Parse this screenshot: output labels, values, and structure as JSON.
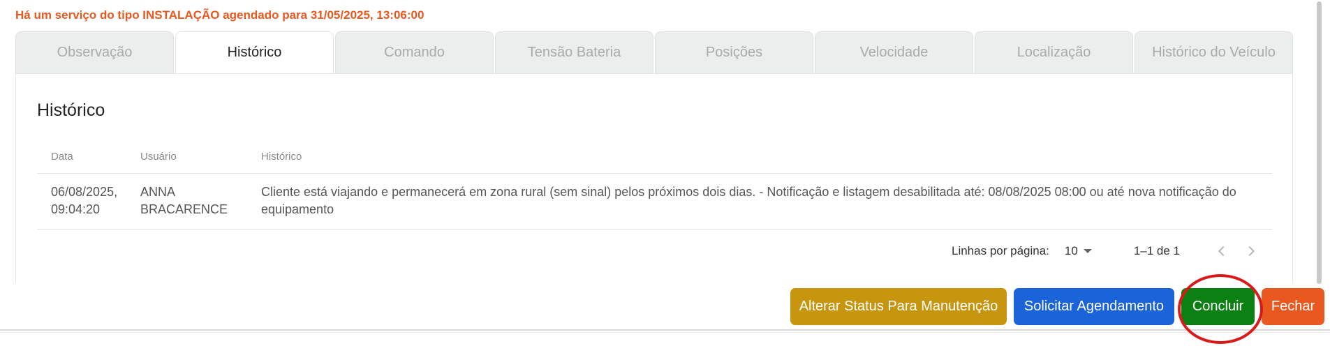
{
  "notice": "Há um serviço do tipo INSTALAÇÃO agendado para 31/05/2025, 13:06:00",
  "tabs": [
    {
      "label": "Observação"
    },
    {
      "label": "Histórico"
    },
    {
      "label": "Comando"
    },
    {
      "label": "Tensão Bateria"
    },
    {
      "label": "Posições"
    },
    {
      "label": "Velocidade"
    },
    {
      "label": "Localização"
    },
    {
      "label": "Histórico do Veículo"
    }
  ],
  "panel": {
    "title": "Histórico",
    "columns": [
      "Data",
      "Usuário",
      "Histórico"
    ],
    "rows": [
      {
        "date": "06/08/2025, 09:04:20",
        "user": "ANNA BRACARENCE",
        "history": "Cliente está viajando e permanecerá em zona rural (sem sinal) pelos próximos dois dias. - Notificação e listagem desabilitada até: 08/08/2025 08:00 ou até nova notificação do equipamento"
      }
    ],
    "pagination": {
      "rows_per_page_label": "Linhas por página:",
      "rows_per_page": "10",
      "range": "1–1 de 1"
    }
  },
  "actions": {
    "maintenance": "Alterar Status Para Manutenção",
    "schedule": "Solicitar Agendamento",
    "conclude": "Concluir",
    "close": "Fechar"
  },
  "colors": {
    "notice": "#e8581f",
    "maintenance": "#c7950e",
    "schedule": "#1a63d8",
    "conclude": "#0c8012",
    "close": "#e8581f",
    "highlight": "#d91a1a"
  }
}
